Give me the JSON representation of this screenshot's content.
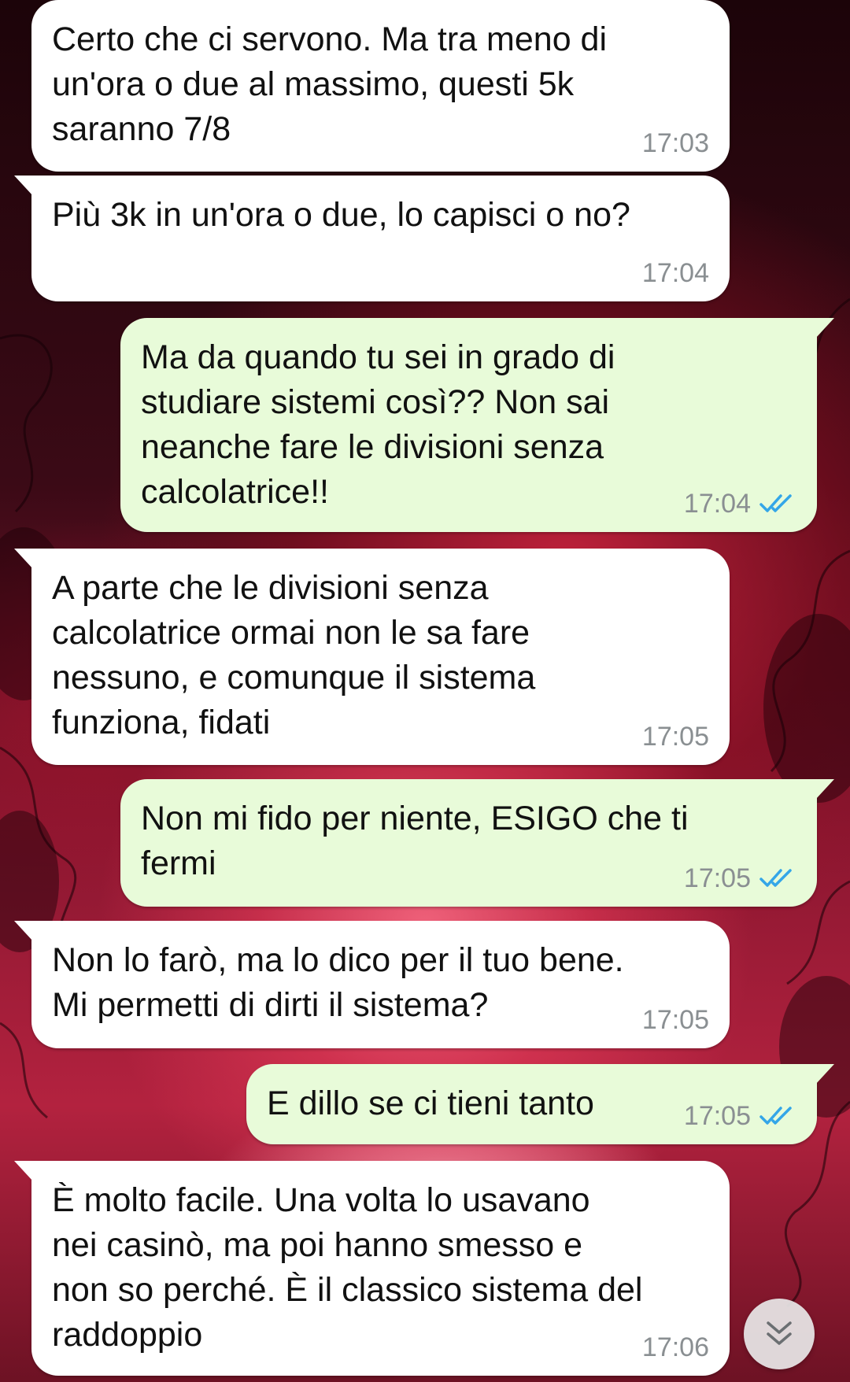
{
  "conversation": {
    "messages": [
      {
        "direction": "incoming",
        "text": "Certo che ci servono. Ma tra meno di\nun'ora o due al massimo, questi 5k\nsaranno 7/8",
        "time": "17:03"
      },
      {
        "direction": "incoming",
        "text": "Più 3k in un'ora o due, lo capisci o no?",
        "time": "17:04"
      },
      {
        "direction": "outgoing",
        "text": "Ma da quando tu sei in grado di\nstudiare sistemi così?? Non sai\nneanche fare le divisioni senza\ncalcolatrice!!",
        "time": "17:04",
        "status": "read"
      },
      {
        "direction": "incoming",
        "text": "A parte che le divisioni senza\ncalcolatrice ormai non le sa fare\nnessuno, e comunque il sistema\nfunziona, fidati",
        "time": "17:05"
      },
      {
        "direction": "outgoing",
        "text": "Non mi fido per niente, ESIGO che ti\nfermi",
        "time": "17:05",
        "status": "read"
      },
      {
        "direction": "incoming",
        "text": "Non lo farò, ma lo dico per il tuo bene.\nMi permetti di dirti il sistema?",
        "time": "17:05"
      },
      {
        "direction": "outgoing",
        "text": "E dillo se ci tieni tanto",
        "time": "17:05",
        "status": "read"
      },
      {
        "direction": "incoming",
        "text": "È molto facile. Una volta lo usavano\nnei casinò, ma poi hanno smesso e\nnon so perché. È il classico sistema del\nraddoppio",
        "time": "17:06"
      }
    ]
  },
  "colors": {
    "incoming_bubble": "#ffffff",
    "outgoing_bubble": "#e8fbd9",
    "timestamp": "#8a8f92",
    "read_ticks": "#34a6e8"
  },
  "icons": {
    "read_status": "double-check-icon",
    "scroll_down": "double-chevron-down-icon"
  }
}
